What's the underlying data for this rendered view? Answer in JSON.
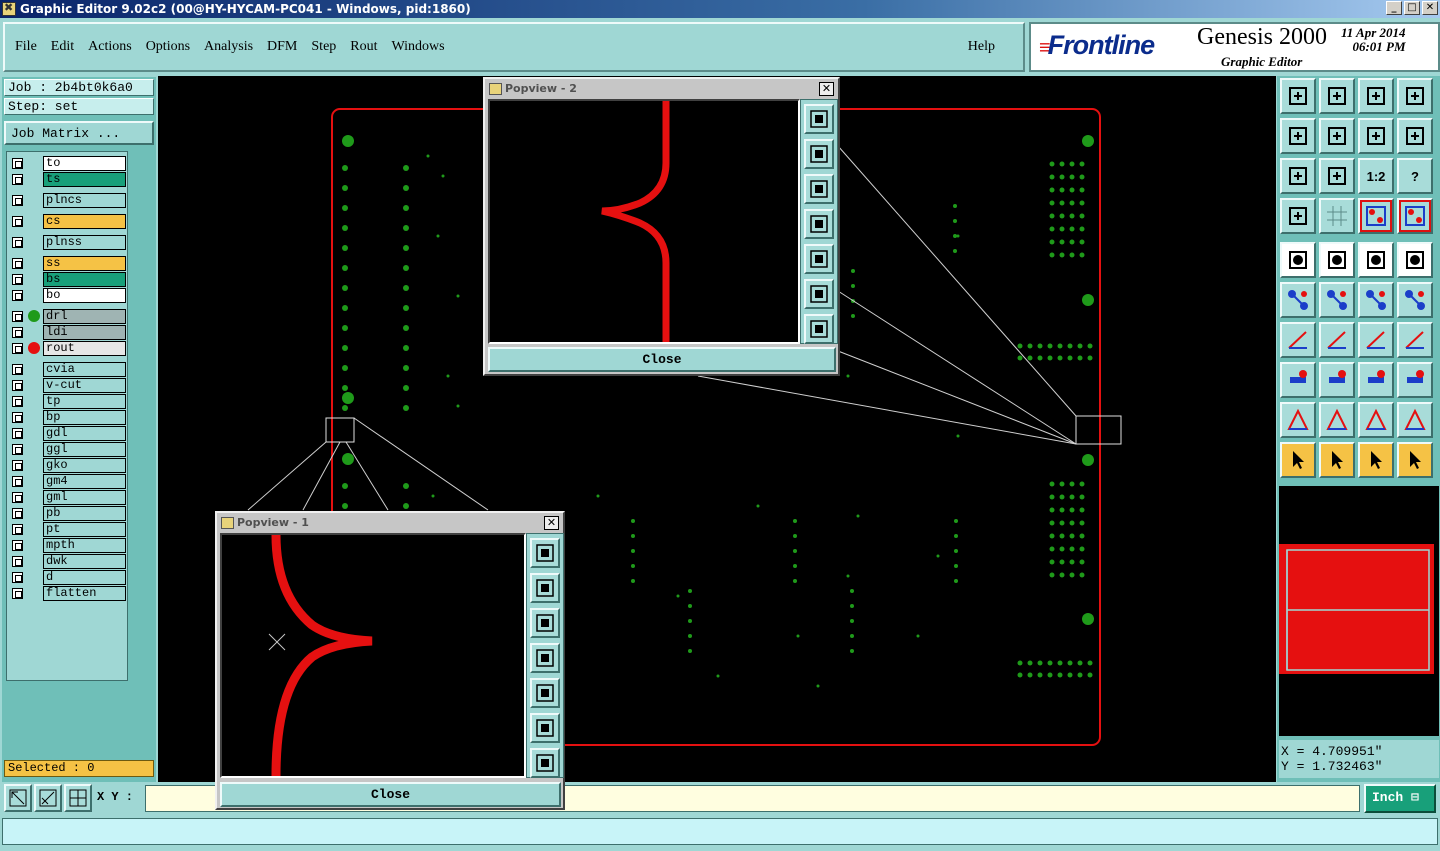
{
  "window": {
    "title": "Graphic Editor 9.02c2 (00@HY-HYCAM-PC041 - Windows, pid:1860)",
    "min": "_",
    "max": "□",
    "close": "✕"
  },
  "menu": {
    "items": [
      "File",
      "Edit",
      "Actions",
      "Options",
      "Analysis",
      "DFM",
      "Step",
      "Rout",
      "Windows"
    ],
    "help": "Help"
  },
  "brand": {
    "logo_prefix": "F",
    "logo": "rontline",
    "product": "Genesis 2000",
    "date": "11 Apr 2014",
    "time": "06:01 PM",
    "subtitle": "Graphic Editor"
  },
  "job": {
    "job_line": "Job : 2b4bt0k6a0",
    "step_line": "Step: set",
    "matrix_button": "Job Matrix ..."
  },
  "layers": [
    {
      "name": "to",
      "color": "#ffffff"
    },
    {
      "name": "ts",
      "color": "#18a07a"
    },
    {
      "name": "plncs",
      "color": "#9fd7d4"
    },
    {
      "name": "cs",
      "color": "#f5c245"
    },
    {
      "name": "plnss",
      "color": "#9fd7d4"
    },
    {
      "name": "ss",
      "color": "#f5c245"
    },
    {
      "name": "bs",
      "color": "#18a07a"
    },
    {
      "name": "bo",
      "color": "#ffffff"
    },
    {
      "name": "drl",
      "color": "#9fb4b3",
      "dot": "#1f9a1a"
    },
    {
      "name": "ldi",
      "color": "#9fb4b3"
    },
    {
      "name": "rout",
      "color": "#e6e6e6",
      "dot": "#e51010"
    },
    {
      "name": "cvia",
      "color": "#9fd7d4"
    },
    {
      "name": "v-cut",
      "color": "#9fd7d4"
    },
    {
      "name": "tp",
      "color": "#9fd7d4"
    },
    {
      "name": "bp",
      "color": "#9fd7d4"
    },
    {
      "name": "gdl",
      "color": "#9fd7d4"
    },
    {
      "name": "ggl",
      "color": "#9fd7d4"
    },
    {
      "name": "gko",
      "color": "#9fd7d4"
    },
    {
      "name": "gm4",
      "color": "#9fd7d4"
    },
    {
      "name": "gml",
      "color": "#9fd7d4"
    },
    {
      "name": "pb",
      "color": "#9fd7d4"
    },
    {
      "name": "pt",
      "color": "#9fd7d4"
    },
    {
      "name": "mpth",
      "color": "#9fd7d4"
    },
    {
      "name": "dwk",
      "color": "#9fd7d4"
    },
    {
      "name": "d",
      "color": "#9fd7d4"
    },
    {
      "name": "flatten",
      "color": "#9fd7d4"
    }
  ],
  "selected": "Selected : 0",
  "coords": {
    "x": "X = 4.709951\"",
    "y": "Y = 1.732463\""
  },
  "bottom": {
    "xy_label": "X Y :",
    "xy_value": "",
    "units": "Inch ⊟"
  },
  "popview2": {
    "title": "Popview - 2",
    "close": "Close"
  },
  "popview1": {
    "title": "Popview - 1",
    "close": "Close"
  },
  "toolbar_rows": [
    [
      "home-up",
      "save-down",
      "house",
      "window"
    ],
    [
      "left-in",
      "right-out",
      "rotate",
      "s-shape"
    ],
    [
      "fit-all",
      "fit-center",
      "1:2",
      "help"
    ],
    [
      "tools",
      "grid",
      "route-red",
      "route-red2"
    ],
    [
      "pointer-box",
      "draw-red",
      "ruler",
      "dot"
    ],
    [
      "net",
      "cross",
      "connect",
      "connect2"
    ],
    [
      "angle",
      "line",
      "curve",
      "split"
    ],
    [
      "snap",
      "bar",
      "measure",
      "blob"
    ],
    [
      "tri",
      "tri-blue",
      "tri-red",
      "tri-mix"
    ],
    [
      "arrow",
      "arrow-box",
      "arrow-box2",
      "path"
    ]
  ],
  "toolbar_labels": {
    "ratio": "1:2",
    "help": "?"
  },
  "colors": {
    "board_outline": "#e51010",
    "pads": "#1f9a1a",
    "accent": "#18a07a"
  }
}
